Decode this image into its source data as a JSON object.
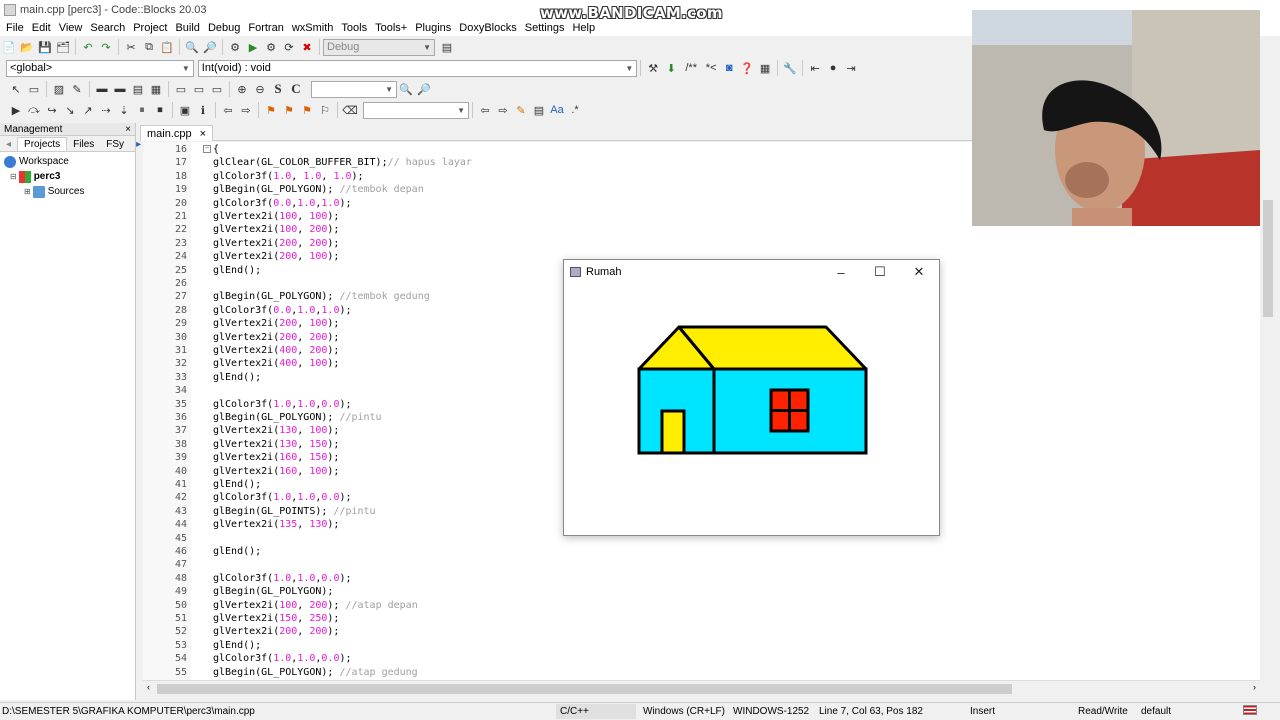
{
  "window": {
    "title": "main.cpp [perc3] - Code::Blocks 20.03"
  },
  "watermark": "www.BANDICAM.com",
  "menu": [
    "File",
    "Edit",
    "View",
    "Search",
    "Project",
    "Build",
    "Debug",
    "Fortran",
    "wxSmith",
    "Tools",
    "Tools+",
    "Plugins",
    "DoxyBlocks",
    "Settings",
    "Help"
  ],
  "toolbar": {
    "build_target": "Debug",
    "scope": "<global>",
    "symbol": "Int(void) : void",
    "doxy": [
      "/**",
      "*<"
    ],
    "text_tools": [
      "S",
      "C"
    ]
  },
  "management": {
    "title": "Management",
    "close": "×",
    "tabs": [
      "Projects",
      "Files",
      "FSy"
    ],
    "tree": {
      "workspace": "Workspace",
      "project": "perc3",
      "folder": "Sources"
    }
  },
  "editor": {
    "tab_label": "main.cpp",
    "tab_close": "×",
    "lines": [
      {
        "n": "16",
        "t": [
          {
            "k": "b",
            "v": "{"
          }
        ]
      },
      {
        "n": "17",
        "t": [
          {
            "k": "b",
            "v": "glClear(GL_COLOR_BUFFER_BIT);"
          },
          {
            "k": "c",
            "v": "// hapus layar"
          }
        ]
      },
      {
        "n": "18",
        "t": [
          {
            "k": "b",
            "v": "glColor3f("
          },
          {
            "k": "n",
            "v": "1.0"
          },
          {
            "k": "b",
            "v": ", "
          },
          {
            "k": "n",
            "v": "1.0"
          },
          {
            "k": "b",
            "v": ", "
          },
          {
            "k": "n",
            "v": "1.0"
          },
          {
            "k": "b",
            "v": ");"
          }
        ]
      },
      {
        "n": "19",
        "t": [
          {
            "k": "b",
            "v": "glBegin(GL_POLYGON); "
          },
          {
            "k": "c",
            "v": "//tembok depan"
          }
        ]
      },
      {
        "n": "20",
        "t": [
          {
            "k": "b",
            "v": "glColor3f("
          },
          {
            "k": "n",
            "v": "0.0"
          },
          {
            "k": "b",
            "v": ","
          },
          {
            "k": "n",
            "v": "1.0"
          },
          {
            "k": "b",
            "v": ","
          },
          {
            "k": "n",
            "v": "1.0"
          },
          {
            "k": "b",
            "v": ");"
          }
        ]
      },
      {
        "n": "21",
        "t": [
          {
            "k": "b",
            "v": "glVertex2i("
          },
          {
            "k": "n",
            "v": "100"
          },
          {
            "k": "b",
            "v": ", "
          },
          {
            "k": "n",
            "v": "100"
          },
          {
            "k": "b",
            "v": ");"
          }
        ]
      },
      {
        "n": "22",
        "t": [
          {
            "k": "b",
            "v": "glVertex2i("
          },
          {
            "k": "n",
            "v": "100"
          },
          {
            "k": "b",
            "v": ", "
          },
          {
            "k": "n",
            "v": "200"
          },
          {
            "k": "b",
            "v": ");"
          }
        ]
      },
      {
        "n": "23",
        "t": [
          {
            "k": "b",
            "v": "glVertex2i("
          },
          {
            "k": "n",
            "v": "200"
          },
          {
            "k": "b",
            "v": ", "
          },
          {
            "k": "n",
            "v": "200"
          },
          {
            "k": "b",
            "v": ");"
          }
        ]
      },
      {
        "n": "24",
        "t": [
          {
            "k": "b",
            "v": "glVertex2i("
          },
          {
            "k": "n",
            "v": "200"
          },
          {
            "k": "b",
            "v": ", "
          },
          {
            "k": "n",
            "v": "100"
          },
          {
            "k": "b",
            "v": ");"
          }
        ]
      },
      {
        "n": "25",
        "t": [
          {
            "k": "b",
            "v": "glEnd();"
          }
        ]
      },
      {
        "n": "26",
        "t": []
      },
      {
        "n": "27",
        "t": [
          {
            "k": "b",
            "v": "glBegin(GL_POLYGON); "
          },
          {
            "k": "c",
            "v": "//tembok gedung"
          }
        ]
      },
      {
        "n": "28",
        "t": [
          {
            "k": "b",
            "v": "glColor3f("
          },
          {
            "k": "n",
            "v": "0.0"
          },
          {
            "k": "b",
            "v": ","
          },
          {
            "k": "n",
            "v": "1.0"
          },
          {
            "k": "b",
            "v": ","
          },
          {
            "k": "n",
            "v": "1.0"
          },
          {
            "k": "b",
            "v": ");"
          }
        ]
      },
      {
        "n": "29",
        "t": [
          {
            "k": "b",
            "v": "glVertex2i("
          },
          {
            "k": "n",
            "v": "200"
          },
          {
            "k": "b",
            "v": ", "
          },
          {
            "k": "n",
            "v": "100"
          },
          {
            "k": "b",
            "v": ");"
          }
        ]
      },
      {
        "n": "30",
        "t": [
          {
            "k": "b",
            "v": "glVertex2i("
          },
          {
            "k": "n",
            "v": "200"
          },
          {
            "k": "b",
            "v": ", "
          },
          {
            "k": "n",
            "v": "200"
          },
          {
            "k": "b",
            "v": ");"
          }
        ]
      },
      {
        "n": "31",
        "t": [
          {
            "k": "b",
            "v": "glVertex2i("
          },
          {
            "k": "n",
            "v": "400"
          },
          {
            "k": "b",
            "v": ", "
          },
          {
            "k": "n",
            "v": "200"
          },
          {
            "k": "b",
            "v": ");"
          }
        ]
      },
      {
        "n": "32",
        "t": [
          {
            "k": "b",
            "v": "glVertex2i("
          },
          {
            "k": "n",
            "v": "400"
          },
          {
            "k": "b",
            "v": ", "
          },
          {
            "k": "n",
            "v": "100"
          },
          {
            "k": "b",
            "v": ");"
          }
        ]
      },
      {
        "n": "33",
        "t": [
          {
            "k": "b",
            "v": "glEnd();"
          }
        ]
      },
      {
        "n": "34",
        "t": []
      },
      {
        "n": "35",
        "t": [
          {
            "k": "b",
            "v": "glColor3f("
          },
          {
            "k": "n",
            "v": "1.0"
          },
          {
            "k": "b",
            "v": ","
          },
          {
            "k": "n",
            "v": "1.0"
          },
          {
            "k": "b",
            "v": ","
          },
          {
            "k": "n",
            "v": "0.0"
          },
          {
            "k": "b",
            "v": ");"
          }
        ]
      },
      {
        "n": "36",
        "t": [
          {
            "k": "b",
            "v": "glBegin(GL_POLYGON); "
          },
          {
            "k": "c",
            "v": "//pintu"
          }
        ]
      },
      {
        "n": "37",
        "t": [
          {
            "k": "b",
            "v": "glVertex2i("
          },
          {
            "k": "n",
            "v": "130"
          },
          {
            "k": "b",
            "v": ", "
          },
          {
            "k": "n",
            "v": "100"
          },
          {
            "k": "b",
            "v": ");"
          }
        ]
      },
      {
        "n": "38",
        "t": [
          {
            "k": "b",
            "v": "glVertex2i("
          },
          {
            "k": "n",
            "v": "130"
          },
          {
            "k": "b",
            "v": ", "
          },
          {
            "k": "n",
            "v": "150"
          },
          {
            "k": "b",
            "v": ");"
          }
        ]
      },
      {
        "n": "39",
        "t": [
          {
            "k": "b",
            "v": "glVertex2i("
          },
          {
            "k": "n",
            "v": "160"
          },
          {
            "k": "b",
            "v": ", "
          },
          {
            "k": "n",
            "v": "150"
          },
          {
            "k": "b",
            "v": ");"
          }
        ]
      },
      {
        "n": "40",
        "t": [
          {
            "k": "b",
            "v": "glVertex2i("
          },
          {
            "k": "n",
            "v": "160"
          },
          {
            "k": "b",
            "v": ", "
          },
          {
            "k": "n",
            "v": "100"
          },
          {
            "k": "b",
            "v": ");"
          }
        ]
      },
      {
        "n": "41",
        "t": [
          {
            "k": "b",
            "v": "glEnd();"
          }
        ]
      },
      {
        "n": "42",
        "t": [
          {
            "k": "b",
            "v": "glColor3f("
          },
          {
            "k": "n",
            "v": "1.0"
          },
          {
            "k": "b",
            "v": ","
          },
          {
            "k": "n",
            "v": "1.0"
          },
          {
            "k": "b",
            "v": ","
          },
          {
            "k": "n",
            "v": "0.0"
          },
          {
            "k": "b",
            "v": ");"
          }
        ]
      },
      {
        "n": "43",
        "t": [
          {
            "k": "b",
            "v": "glBegin(GL_POINTS); "
          },
          {
            "k": "c",
            "v": "//pintu"
          }
        ]
      },
      {
        "n": "44",
        "t": [
          {
            "k": "b",
            "v": "glVertex2i("
          },
          {
            "k": "n",
            "v": "135"
          },
          {
            "k": "b",
            "v": ", "
          },
          {
            "k": "n",
            "v": "130"
          },
          {
            "k": "b",
            "v": ");"
          }
        ]
      },
      {
        "n": "45",
        "t": []
      },
      {
        "n": "46",
        "t": [
          {
            "k": "b",
            "v": "glEnd();"
          }
        ]
      },
      {
        "n": "47",
        "t": []
      },
      {
        "n": "48",
        "t": [
          {
            "k": "b",
            "v": "glColor3f("
          },
          {
            "k": "n",
            "v": "1.0"
          },
          {
            "k": "b",
            "v": ","
          },
          {
            "k": "n",
            "v": "1.0"
          },
          {
            "k": "b",
            "v": ","
          },
          {
            "k": "n",
            "v": "0.0"
          },
          {
            "k": "b",
            "v": ");"
          }
        ]
      },
      {
        "n": "49",
        "t": [
          {
            "k": "b",
            "v": "glBegin(GL_POLYGON);"
          }
        ]
      },
      {
        "n": "50",
        "t": [
          {
            "k": "b",
            "v": "glVertex2i("
          },
          {
            "k": "n",
            "v": "100"
          },
          {
            "k": "b",
            "v": ", "
          },
          {
            "k": "n",
            "v": "200"
          },
          {
            "k": "b",
            "v": "); "
          },
          {
            "k": "c",
            "v": "//atap depan"
          }
        ]
      },
      {
        "n": "51",
        "t": [
          {
            "k": "b",
            "v": "glVertex2i("
          },
          {
            "k": "n",
            "v": "150"
          },
          {
            "k": "b",
            "v": ", "
          },
          {
            "k": "n",
            "v": "250"
          },
          {
            "k": "b",
            "v": ");"
          }
        ]
      },
      {
        "n": "52",
        "t": [
          {
            "k": "b",
            "v": "glVertex2i("
          },
          {
            "k": "n",
            "v": "200"
          },
          {
            "k": "b",
            "v": ", "
          },
          {
            "k": "n",
            "v": "200"
          },
          {
            "k": "b",
            "v": ");"
          }
        ]
      },
      {
        "n": "53",
        "t": [
          {
            "k": "b",
            "v": "glEnd();"
          }
        ]
      },
      {
        "n": "54",
        "t": [
          {
            "k": "b",
            "v": "glColor3f("
          },
          {
            "k": "n",
            "v": "1.0"
          },
          {
            "k": "b",
            "v": ","
          },
          {
            "k": "n",
            "v": "1.0"
          },
          {
            "k": "b",
            "v": ","
          },
          {
            "k": "n",
            "v": "0.0"
          },
          {
            "k": "b",
            "v": ");"
          }
        ]
      },
      {
        "n": "55",
        "t": [
          {
            "k": "b",
            "v": "glBegin(GL_POLYGON); "
          },
          {
            "k": "c",
            "v": "//atap gedung"
          }
        ]
      }
    ]
  },
  "glwindow": {
    "title": "Rumah",
    "minimize": "–",
    "maximize": "☐",
    "close": "✕",
    "colors": {
      "wall": "#00e5ff",
      "roof": "#ffee00",
      "door": "#ffee00",
      "window": "#ff2200",
      "outline": "#000000"
    }
  },
  "statusbar": {
    "path": "D:\\SEMESTER 5\\GRAFIKA KOMPUTER\\perc3\\main.cpp",
    "language": "C/C++",
    "eol": "Windows (CR+LF)",
    "encoding": "WINDOWS-1252",
    "position": "Line 7, Col 63, Pos 182",
    "mode": "Insert",
    "access": "Read/Write",
    "profile": "default"
  }
}
